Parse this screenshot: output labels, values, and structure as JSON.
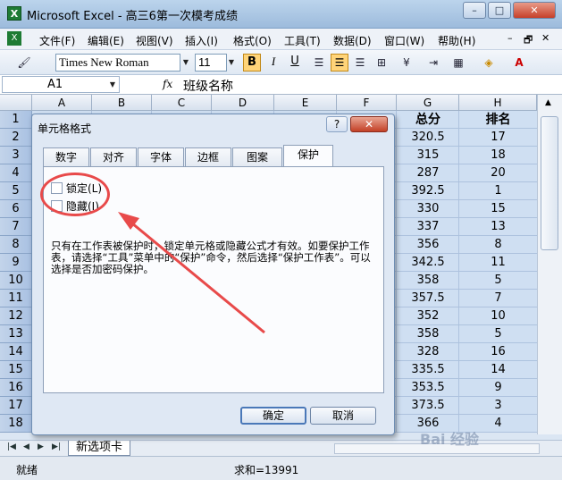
{
  "window": {
    "app_icon": "X",
    "title": "Microsoft Excel - 高三6第一次模考成绩",
    "buttons": [
      "–",
      "□",
      "✕"
    ]
  },
  "menu": {
    "items": [
      "文件(F)",
      "编辑(E)",
      "视图(V)",
      "插入(I)",
      "格式(O)",
      "工具(T)",
      "数据(D)",
      "窗口(W)",
      "帮助(H)"
    ],
    "mdi": [
      "–",
      "🗗",
      "✕"
    ]
  },
  "toolbar": {
    "font_name": "Times New Roman",
    "font_size": "11",
    "bold": "B",
    "italic": "I",
    "underline": "U",
    "accent": "#ffd479"
  },
  "formula_bar": {
    "cell_ref": "A1",
    "fx": "fx",
    "content": "班级名称"
  },
  "columns": [
    "A",
    "B",
    "C",
    "D",
    "E",
    "F",
    "G",
    "H"
  ],
  "rows": [
    "1",
    "2",
    "3",
    "4",
    "5",
    "6",
    "7",
    "8",
    "9",
    "10",
    "11",
    "12",
    "13",
    "14",
    "15",
    "16",
    "17",
    "18"
  ],
  "visible_cells": {
    "G": [
      "总分",
      "320.5",
      "315",
      "287",
      "392.5",
      "330",
      "337",
      "356",
      "342.5",
      "358",
      "357.5",
      "352",
      "358",
      "328",
      "335.5",
      "353.5",
      "373.5",
      "366"
    ],
    "H": [
      "排名",
      "17",
      "18",
      "20",
      "1",
      "15",
      "13",
      "8",
      "11",
      "5",
      "7",
      "10",
      "5",
      "16",
      "14",
      "9",
      "3",
      "4"
    ]
  },
  "sheet_tab": "新选项卡",
  "tab_nav": [
    "|◀",
    "◀",
    "▶",
    "▶|"
  ],
  "status": {
    "ready": "就绪",
    "sum": "求和=13991"
  },
  "dialog": {
    "title": "单元格格式",
    "help": "?",
    "close": "✕",
    "tabs": [
      "数字",
      "对齐",
      "字体",
      "边框",
      "图案",
      "保护"
    ],
    "active_tab": "保护",
    "checkbox_locked": "锁定(L)",
    "checkbox_hidden": "隐藏(I)",
    "description": "只有在工作表被保护时，锁定单元格或隐藏公式才有效。如要保护工作表，请选择“工具”菜单中的“保护”命令，然后选择“保护工作表”。可以选择是否加密码保护。",
    "ok": "确定",
    "cancel": "取消"
  },
  "annotation": {
    "arrow_color": "#e84a4a"
  },
  "watermark": "Bai 经验"
}
